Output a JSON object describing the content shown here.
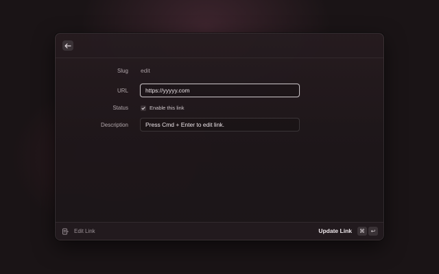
{
  "form": {
    "slug_label": "Slug",
    "slug_value": "edit",
    "url_label": "URL",
    "url_value": "https://yyyyy.com",
    "status_label": "Status",
    "status_checkbox_label": "Enable this link",
    "status_checked": true,
    "description_label": "Description",
    "description_value": "Press Cmd + Enter to edit link."
  },
  "footer": {
    "title": "Edit Link",
    "primary_action": "Update Link",
    "shortcut_keys": [
      "⌘",
      "↩"
    ]
  },
  "icons": {
    "back": "arrow-left-icon",
    "footer": "edit-link-icon",
    "check": "checkmark-icon"
  }
}
